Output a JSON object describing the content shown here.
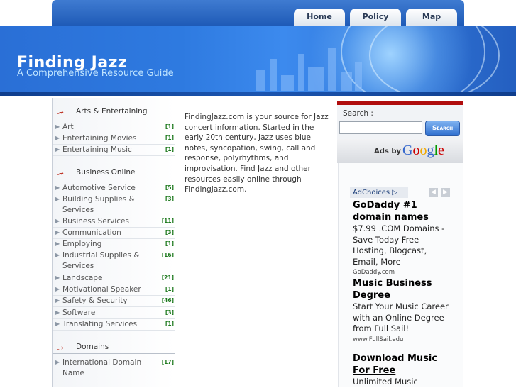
{
  "nav": {
    "tabs": [
      "Home",
      "Policy",
      "Map"
    ]
  },
  "header": {
    "title": "Finding Jazz",
    "subtitle": "A Comprehensive Resource Guide"
  },
  "sidebar": {
    "categories": [
      {
        "heading": "Arts & Entertaining",
        "items": [
          {
            "name": "Art",
            "count": "[1]"
          },
          {
            "name": "Entertaining Movies",
            "count": "[1]"
          },
          {
            "name": "Entertaining Music",
            "count": "[1]"
          }
        ]
      },
      {
        "heading": "Business Online",
        "items": [
          {
            "name": "Automotive Service",
            "count": "[5]"
          },
          {
            "name": "Building Supplies & Services",
            "count": "[3]"
          },
          {
            "name": "Business Services",
            "count": "[11]"
          },
          {
            "name": "Communication",
            "count": "[3]"
          },
          {
            "name": "Employing",
            "count": "[1]"
          },
          {
            "name": "Industrial Supplies & Services",
            "count": "[16]"
          },
          {
            "name": "Landscape",
            "count": "[21]"
          },
          {
            "name": "Motivational Speaker",
            "count": "[1]"
          },
          {
            "name": "Safety & Security",
            "count": "[46]"
          },
          {
            "name": "Software",
            "count": "[3]"
          },
          {
            "name": "Translating Services",
            "count": "[1]"
          }
        ]
      },
      {
        "heading": "Domains",
        "items": [
          {
            "name": "International Domain Name",
            "count": "[17]"
          }
        ]
      }
    ]
  },
  "content": {
    "intro": "FindingJazz.com is your source for Jazz concert information. Started in the early 20th century, Jazz uses blue notes, syncopation, swing, call and response, polyrhythms, and improvisation. Find Jazz and other resources easily online through FindingJazz.com."
  },
  "search": {
    "label": "Search :",
    "button": "Search",
    "value": ""
  },
  "ads": {
    "ads_by": "Ads by",
    "google": [
      "G",
      "o",
      "o",
      "g",
      "l",
      "e"
    ],
    "adchoices": "AdChoices",
    "items": [
      {
        "title_plain": "GoDaddy #1",
        "title_link": "domain names",
        "desc": "$7.99 .COM Domains - Save Today Free Hosting, Blogcast, Email, More",
        "url": "GoDaddy.com"
      },
      {
        "title_plain": "",
        "title_link": "Music Business Degree",
        "desc": "Start Your Music Career with an Online Degree from Full Sail!",
        "url": "www.FullSail.edu"
      },
      {
        "title_plain": "",
        "title_link": "Download Music For Free",
        "desc": "Unlimited Music",
        "url": ""
      }
    ]
  },
  "colors": {
    "nav_blue": "#2a67c6",
    "banner_blue": "#2e7ae0",
    "search_accent": "#b00d0d",
    "count_green": "#1e7a1e"
  }
}
